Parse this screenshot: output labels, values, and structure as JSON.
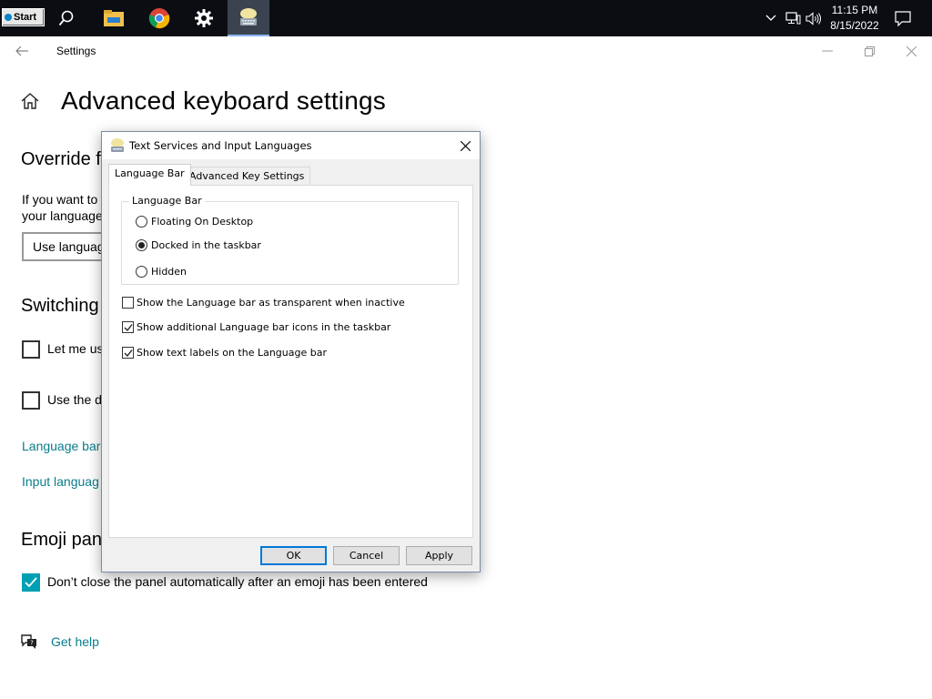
{
  "taskbar": {
    "start_label": "Start",
    "time": "11:15 PM",
    "date": "8/15/2022"
  },
  "settings": {
    "window_title": "Settings",
    "page_title": "Advanced keyboard settings",
    "override_heading": "Override f",
    "override_text_line1": "If you want to",
    "override_text_line2": "your language",
    "dropdown_value": "Use languag",
    "switching_heading": "Switching",
    "checkbox1_label": "Let me us",
    "checkbox2_label": "Use the d",
    "link_language_bar": "Language bar",
    "link_input_language": "Input languag",
    "emoji_heading": "Emoji pan",
    "emoji_checkbox_label": "Don’t close the panel automatically after an emoji has been entered",
    "get_help": "Get help"
  },
  "dialog": {
    "title": "Text Services and Input Languages",
    "tabs": [
      {
        "label": "Language Bar",
        "selected": true
      },
      {
        "label": "Advanced Key Settings",
        "selected": false
      }
    ],
    "group_label": "Language Bar",
    "radios": [
      {
        "label": "Floating On Desktop",
        "checked": false
      },
      {
        "label": "Docked in the taskbar",
        "checked": true
      },
      {
        "label": "Hidden",
        "checked": false
      }
    ],
    "checkboxes": [
      {
        "label": "Show the Language bar as transparent when inactive",
        "checked": false
      },
      {
        "label": "Show additional Language bar icons in the taskbar",
        "checked": true
      },
      {
        "label": "Show text labels on the Language bar",
        "checked": true
      }
    ],
    "buttons": {
      "ok": "OK",
      "cancel": "Cancel",
      "apply": "Apply"
    }
  },
  "colors": {
    "accent": "#00a0b4",
    "link": "#0a7d8c",
    "taskbar": "#0b0d12"
  }
}
